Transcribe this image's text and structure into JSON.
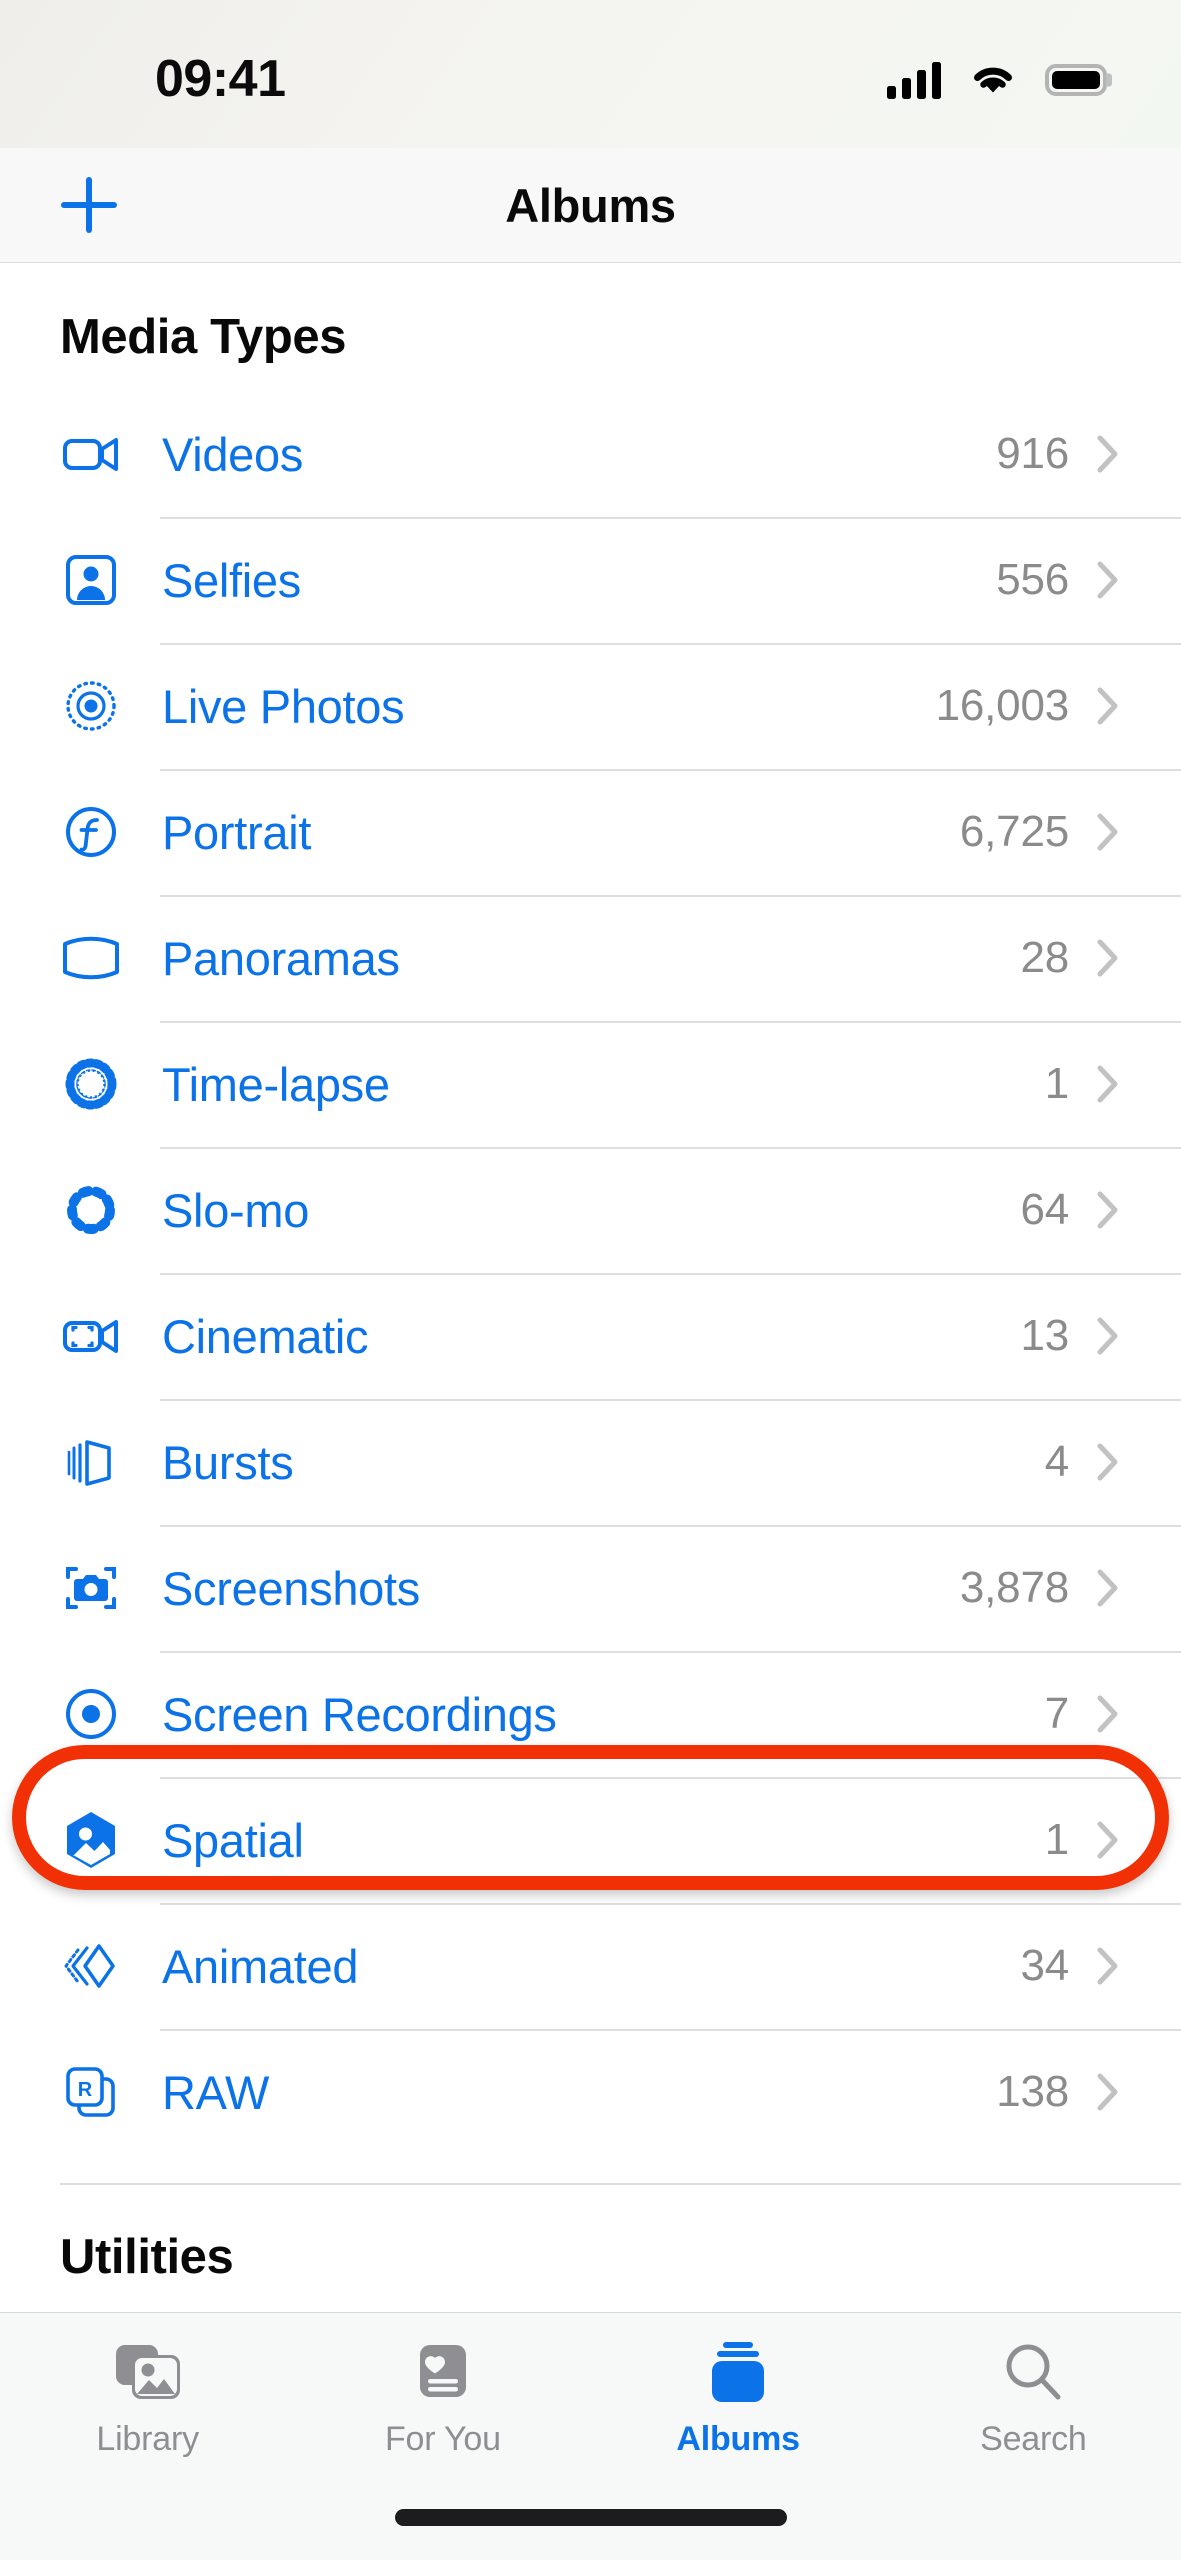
{
  "status_bar": {
    "time": "09:41",
    "signal_icon": "cellular-signal-icon",
    "wifi_icon": "wifi-icon",
    "battery_icon": "battery-icon"
  },
  "nav_bar": {
    "add_icon": "plus-icon",
    "title": "Albums"
  },
  "sections": [
    {
      "header": "Media Types",
      "items": [
        {
          "icon": "video-camera-icon",
          "label": "Videos",
          "count": "916"
        },
        {
          "icon": "person-portrait-icon",
          "label": "Selfies",
          "count": "556"
        },
        {
          "icon": "live-photo-icon",
          "label": "Live Photos",
          "count": "16,003"
        },
        {
          "icon": "f-aperture-icon",
          "label": "Portrait",
          "count": "6,725"
        },
        {
          "icon": "panorama-icon",
          "label": "Panoramas",
          "count": "28"
        },
        {
          "icon": "timelapse-icon",
          "label": "Time-lapse",
          "count": "1"
        },
        {
          "icon": "slomo-icon",
          "label": "Slo-mo",
          "count": "64"
        },
        {
          "icon": "cinematic-video-icon",
          "label": "Cinematic",
          "count": "13"
        },
        {
          "icon": "bursts-stack-icon",
          "label": "Bursts",
          "count": "4"
        },
        {
          "icon": "screenshot-camera-icon",
          "label": "Screenshots",
          "count": "3,878"
        },
        {
          "icon": "screen-recording-icon",
          "label": "Screen Recordings",
          "count": "7"
        },
        {
          "icon": "spatial-hexagon-icon",
          "label": "Spatial",
          "count": "1"
        },
        {
          "icon": "animated-chevrons-icon",
          "label": "Animated",
          "count": "34"
        },
        {
          "icon": "raw-file-icon",
          "label": "RAW",
          "count": "138"
        }
      ]
    },
    {
      "header": "Utilities",
      "items": []
    }
  ],
  "annotation": {
    "highlight_target": "Spatial",
    "color": "#f23005",
    "shape": "rounded-rect-outline"
  },
  "tab_bar": {
    "tabs": [
      {
        "icon": "photo-stack-icon",
        "label": "Library",
        "active": false
      },
      {
        "icon": "heart-card-icon",
        "label": "For You",
        "active": false
      },
      {
        "icon": "albums-stack-icon",
        "label": "Albums",
        "active": true
      },
      {
        "icon": "magnifier-icon",
        "label": "Search",
        "active": false
      }
    ],
    "active_color": "#0b72e8",
    "inactive_color": "#8e8e93"
  }
}
